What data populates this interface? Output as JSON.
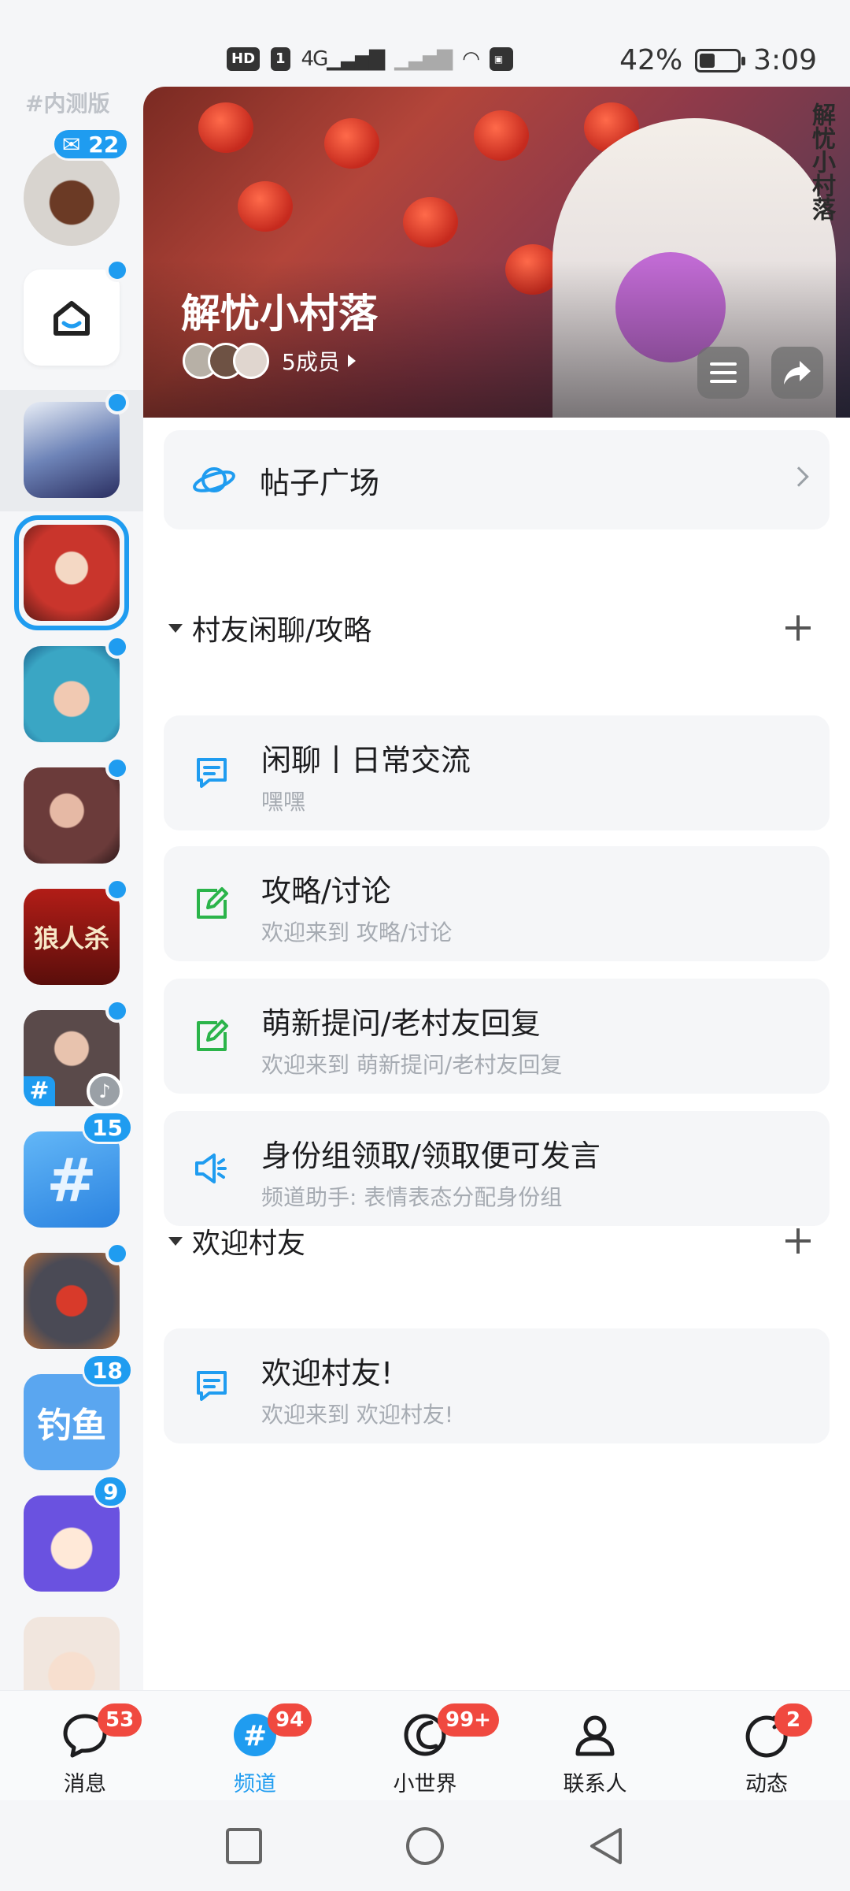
{
  "status_bar": {
    "hd": "HD",
    "sim": "1",
    "network": "4G",
    "battery_percent": "42%",
    "battery_level": 0.42,
    "time": "3:09"
  },
  "rail": {
    "beta_tag": "#内测版",
    "profile_badge": "22",
    "items": [
      {
        "name": "rail-item-home",
        "color": "#ffffff"
      },
      {
        "name": "rail-item-guild-1",
        "color": "#5b6fa6"
      },
      {
        "name": "rail-item-guild-2",
        "color": "#c9352c"
      },
      {
        "name": "rail-item-guild-3",
        "color": "#3aa6c4"
      },
      {
        "name": "rail-item-guild-4",
        "color": "#6b3b3a"
      },
      {
        "name": "rail-item-werewolf",
        "color": "#9e1a16",
        "label": "狼人杀"
      },
      {
        "name": "rail-item-guild-6",
        "color": "#5a4a4a"
      },
      {
        "name": "rail-item-channel-plaza",
        "color": "#3f9ef0",
        "badge": "15"
      },
      {
        "name": "rail-item-guild-8",
        "color": "#8a3b2a"
      },
      {
        "name": "rail-item-fishing",
        "color": "#5aa6f0",
        "label": "钓鱼",
        "badge": "18"
      },
      {
        "name": "rail-item-guild-10",
        "color": "#6a52e0",
        "badge": "9"
      },
      {
        "name": "rail-item-guild-11",
        "color": "#f1e6de"
      }
    ]
  },
  "banner": {
    "title": "解忧小村落",
    "members": "5成员",
    "seal_text": "解忧小村落"
  },
  "post_plaza": {
    "label": "帖子广场"
  },
  "sections": [
    {
      "title": "村友闲聊/攻略",
      "channels": [
        {
          "icon": "chat-bubble-icon",
          "title": "闲聊丨日常交流",
          "subtitle": "嘿嘿"
        },
        {
          "icon": "edit-note-icon",
          "title": "攻略/讨论",
          "subtitle": "欢迎来到 攻略/讨论"
        },
        {
          "icon": "edit-note-icon",
          "title": "萌新提问/老村友回复",
          "subtitle": "欢迎来到 萌新提问/老村友回复"
        },
        {
          "icon": "megaphone-icon",
          "title": "身份组领取/领取便可发言",
          "subtitle": "频道助手: 表情表态分配身份组"
        }
      ]
    },
    {
      "title": "欢迎村友",
      "channels": [
        {
          "icon": "chat-bubble-icon",
          "title": "欢迎村友!",
          "subtitle": "欢迎来到 欢迎村友!"
        }
      ]
    }
  ],
  "bottom_nav": {
    "items": [
      {
        "label": "消息",
        "badge": "53",
        "icon": "message-icon"
      },
      {
        "label": "频道",
        "badge": "94",
        "icon": "channel-hash-icon",
        "active": true
      },
      {
        "label": "小世界",
        "badge": "99+",
        "icon": "small-world-icon"
      },
      {
        "label": "联系人",
        "badge": "",
        "icon": "contacts-icon"
      },
      {
        "label": "动态",
        "badge": "2",
        "icon": "feed-icon"
      }
    ]
  },
  "colors": {
    "accent": "#1f9cf0",
    "badge_red": "#f0493f",
    "green_icon": "#2bb44a"
  }
}
